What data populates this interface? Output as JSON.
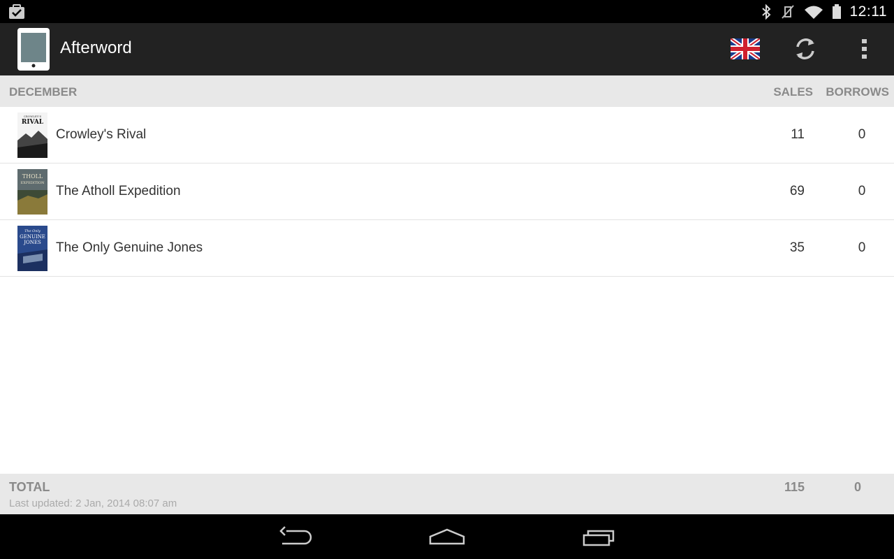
{
  "status_bar": {
    "time": "12:11",
    "icons": [
      "notification-check-icon",
      "bluetooth-icon",
      "vibrate-off-icon",
      "wifi-icon",
      "battery-icon"
    ]
  },
  "action_bar": {
    "title": "Afterword",
    "icons": [
      "app-tablet-icon",
      "uk-flag-icon",
      "refresh-icon",
      "overflow-menu-icon"
    ],
    "background": "#222222"
  },
  "list_header": {
    "month": "DECEMBER",
    "sales_label": "SALES",
    "borrows_label": "BORROWS"
  },
  "rows": [
    {
      "title": "Crowley's Rival",
      "sales": "11",
      "borrows": "0",
      "cover_text": [
        "CROWLEY'S",
        "RIVAL"
      ]
    },
    {
      "title": "The Atholl Expedition",
      "sales": "69",
      "borrows": "0",
      "cover_text": [
        "THOLL",
        "EXPEDITION"
      ]
    },
    {
      "title": "The Only Genuine Jones",
      "sales": "35",
      "borrows": "0",
      "cover_text": [
        "The Only",
        "GENUINE",
        "JONES"
      ]
    }
  ],
  "footer": {
    "total_label": "TOTAL",
    "total_sales": "115",
    "total_borrows": "0",
    "last_updated": "Last updated: 2 Jan, 2014 08:07 am"
  },
  "nav_bar": {
    "icons": [
      "back-icon",
      "home-icon",
      "recent-apps-icon"
    ]
  }
}
